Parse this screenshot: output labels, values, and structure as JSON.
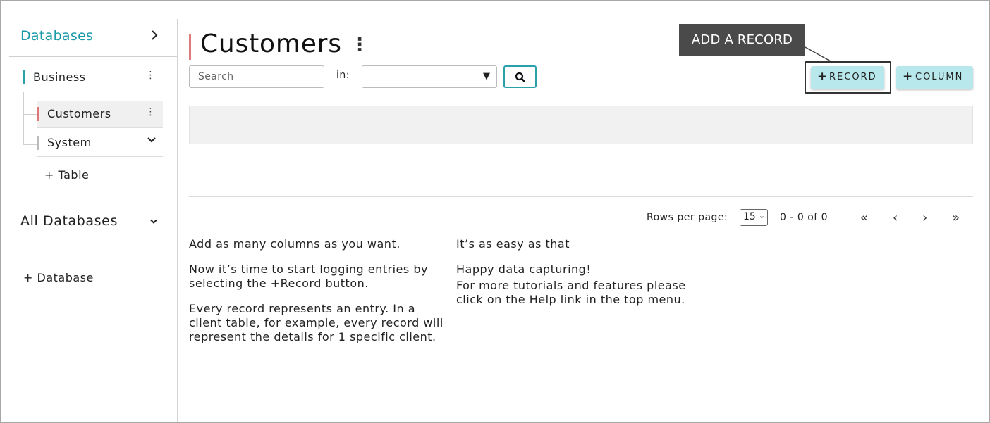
{
  "sidebar": {
    "title": "Databases",
    "items": {
      "business": "Business",
      "customers": "Customers",
      "system": "System",
      "add_table": "+ Table"
    },
    "all_databases": "All Databases",
    "add_database": "+ Database"
  },
  "header": {
    "title": "Customers",
    "kebab": "⋮"
  },
  "search": {
    "placeholder": "Search",
    "in_label": "in:",
    "select_value": ""
  },
  "tooltip": "ADD A RECORD",
  "buttons": {
    "record": "RECORD",
    "column": "COLUMN"
  },
  "pagination": {
    "rows_label": "Rows per page:",
    "rows_value": "15",
    "range": "0 - 0 of 0",
    "first": "«",
    "prev": "‹",
    "next": "›",
    "last": "»"
  },
  "help": {
    "left": [
      "Add as many columns as you want.",
      "Now it’s time to start logging entries by selecting the +Record button.",
      "Every record represents an entry. In a client table, for example, every record will represent the details for 1 specific client."
    ],
    "right": [
      "It’s as easy as that",
      "Happy data capturing!",
      "For more tutorials and features please click on the Help link in the top menu."
    ]
  },
  "colors": {
    "accent": "#1a9aa8",
    "button_bg": "#b8e8ec",
    "active_marker": "#e07a7a",
    "tooltip_bg": "#4a4a4a"
  }
}
